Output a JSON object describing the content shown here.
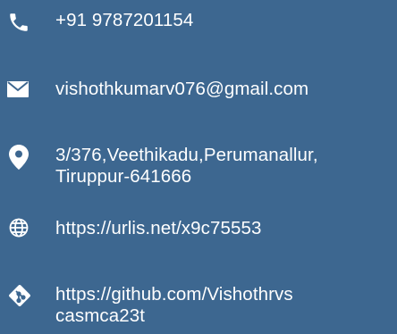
{
  "contact": {
    "phone": {
      "icon": "phone-icon",
      "text": "+91 9787201154"
    },
    "email": {
      "icon": "envelope-icon",
      "text": "vishothkumarv076@gmail.com"
    },
    "address": {
      "icon": "map-pin-icon",
      "line1": "3/376,Veethikadu,Perumanallur,",
      "line2": "Tiruppur-641666"
    },
    "website": {
      "icon": "globe-icon",
      "text": "https://urlis.net/x9c75553"
    },
    "github": {
      "icon": "git-icon",
      "line1": "https://github.com/Vishothrvs",
      "line2": "casmca23t"
    }
  },
  "colors": {
    "background": "#3d6790",
    "text": "#ffffff"
  }
}
